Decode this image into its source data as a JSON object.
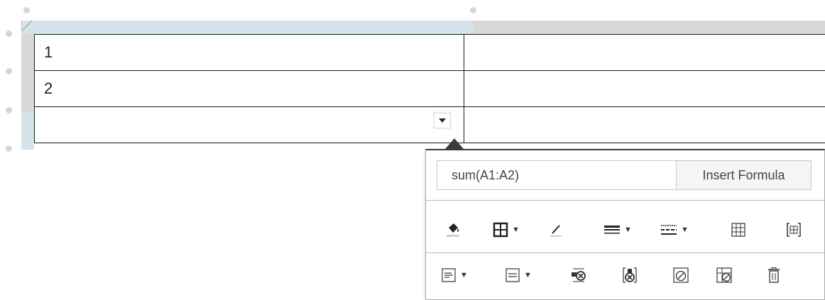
{
  "sheet": {
    "rows": [
      [
        "1",
        ""
      ],
      [
        "2",
        ""
      ],
      [
        "",
        ""
      ]
    ]
  },
  "popup": {
    "formula_value": "sum(A1:A2)",
    "insert_formula_label": "Insert Formula",
    "toolbar_row_1": [
      {
        "icon": "fill-color-icon",
        "dropdown": false
      },
      {
        "icon": "borders-icon",
        "dropdown": true
      },
      {
        "icon": "border-color-icon",
        "dropdown": false
      },
      {
        "icon": "border-width-icon",
        "dropdown": true
      },
      {
        "icon": "border-style-icon",
        "dropdown": true
      },
      {
        "icon": "split-cell-icon",
        "dropdown": false
      },
      {
        "icon": "merge-cells-icon",
        "dropdown": false
      }
    ],
    "toolbar_row_2": [
      {
        "icon": "horizontal-align-icon",
        "dropdown": true
      },
      {
        "icon": "vertical-align-icon",
        "dropdown": true
      },
      {
        "icon": "delete-row-icon",
        "dropdown": false
      },
      {
        "icon": "delete-column-icon",
        "dropdown": false
      },
      {
        "icon": "clear-cell-icon",
        "dropdown": false
      },
      {
        "icon": "clear-table-icon",
        "dropdown": false
      },
      {
        "icon": "delete-table-icon",
        "dropdown": false
      }
    ],
    "caret_glyph": "▼"
  },
  "colors": {
    "header_selected": "#d3e5ea",
    "header_default": "#d8d8d8",
    "grid_border": "#1a1a1a"
  }
}
